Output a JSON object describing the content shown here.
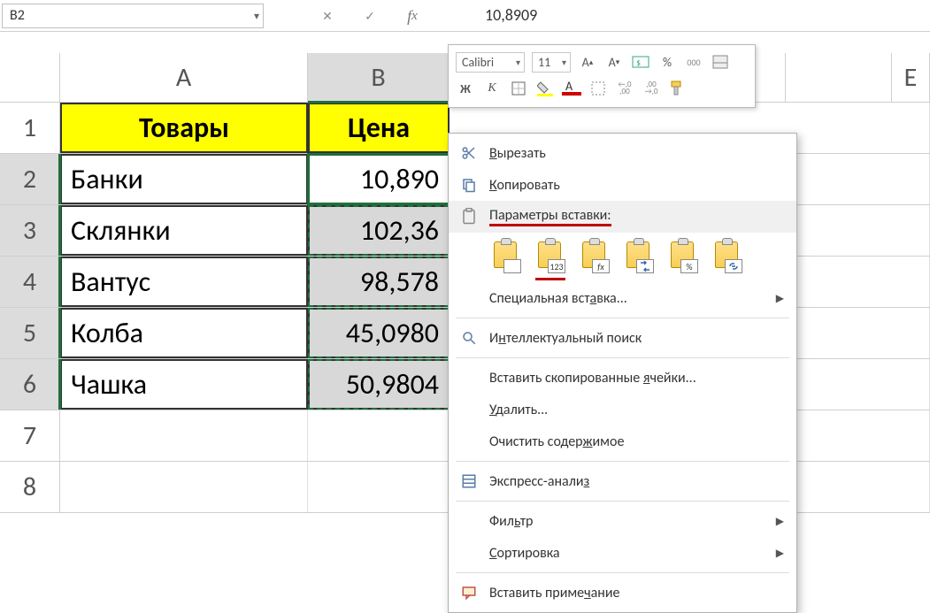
{
  "namebox": "B2",
  "formula_value": "10,8909",
  "mini_toolbar": {
    "font_name": "Calibri",
    "font_size": "11",
    "bold": "Ж",
    "italic": "К",
    "percent": "%",
    "thousands": "000",
    "inc_dec1": "←,0\n,00",
    "inc_dec2": ",00\n→,0"
  },
  "columns": {
    "A": "A",
    "B": "B",
    "E": "E"
  },
  "rows": {
    "header": {
      "A": "Товары",
      "B": "Цена"
    },
    "data": [
      {
        "n": "1"
      },
      {
        "n": "2",
        "A": "Банки",
        "B": "10,890"
      },
      {
        "n": "3",
        "A": "Склянки",
        "B": "102,36"
      },
      {
        "n": "4",
        "A": "Вантус",
        "B": "98,578"
      },
      {
        "n": "5",
        "A": "Колба",
        "B": "45,0980"
      },
      {
        "n": "6",
        "A": "Чашка",
        "B": "50,9804"
      },
      {
        "n": "7"
      },
      {
        "n": "8"
      }
    ]
  },
  "paste_icons": {
    "values_label": "123",
    "fx_label": "fx",
    "pct_label": "%"
  },
  "context_menu": {
    "cut": "Вырезать",
    "copy": "Копировать",
    "paste_options": "Параметры вставки:",
    "paste_special": "Специальная вставка...",
    "smart_lookup": "Интеллектуальный поиск",
    "insert_copied": "Вставить скопированные ячейки...",
    "delete": "Удалить...",
    "clear": "Очистить содержимое",
    "quick_analysis": "Экспресс-анализ",
    "filter": "Фильтр",
    "sort": "Сортировка",
    "insert_comment": "Вставить примечание"
  },
  "chart_data": {
    "type": "table",
    "columns": [
      "Товары",
      "Цена"
    ],
    "rows": [
      [
        "Банки",
        "10,8909"
      ],
      [
        "Склянки",
        "102,36"
      ],
      [
        "Вантус",
        "98,578"
      ],
      [
        "Колба",
        "45,0980"
      ],
      [
        "Чашка",
        "50,9804"
      ]
    ]
  }
}
